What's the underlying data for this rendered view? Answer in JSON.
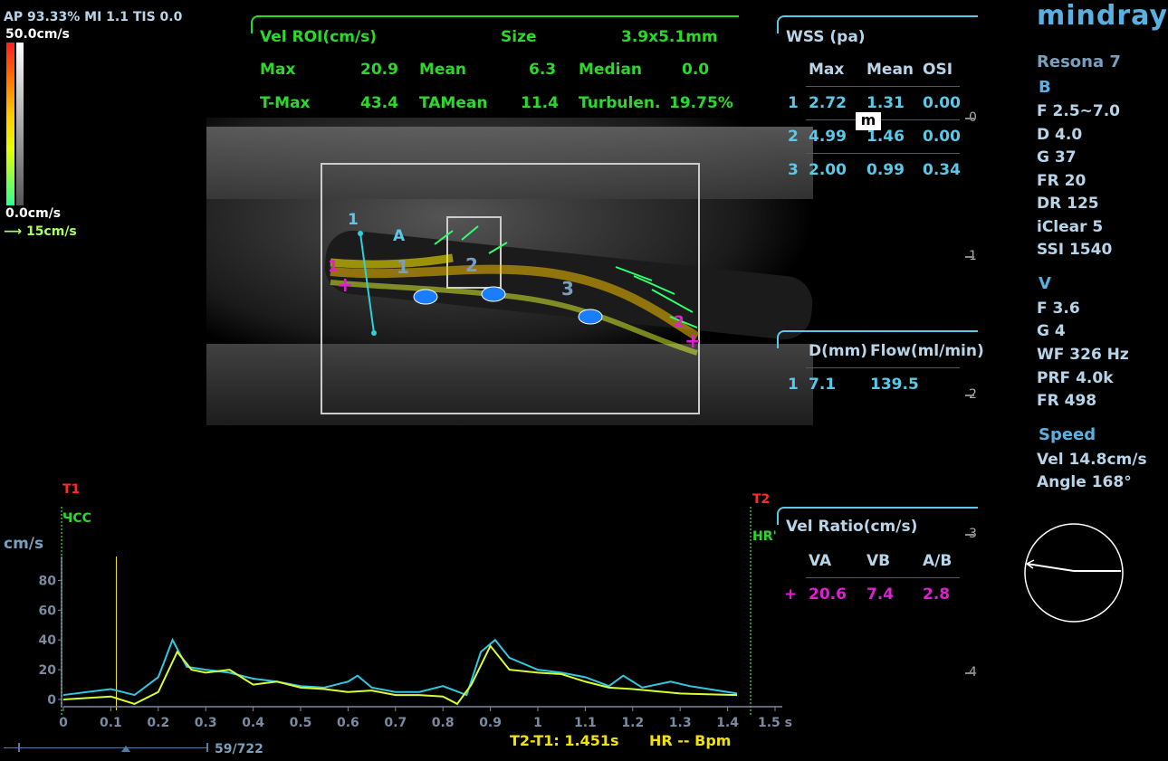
{
  "top_left": {
    "header": "AP 93.33%  MI 1.1 TIS 0.0",
    "scale_max": "50.0cm/s",
    "scale_min": "0.0cm/s",
    "vector_ref": "15cm/s"
  },
  "vel_roi": {
    "title": "Vel ROI(cm/s)",
    "size_label": "Size",
    "size_value": "3.9x5.1mm",
    "max_label": "Max",
    "max_value": "20.9",
    "mean_label": "Mean",
    "mean_value": "6.3",
    "median_label": "Median",
    "median_value": "0.0",
    "tmax_label": "T-Max",
    "tmax_value": "43.4",
    "tamean_label": "TAMean",
    "tamean_value": "11.4",
    "turb_label": "Turbulen.",
    "turb_value": "19.75%"
  },
  "wss": {
    "title": "WSS (pa)",
    "headers": [
      "Max",
      "Mean",
      "OSI"
    ],
    "rows": [
      {
        "idx": "1",
        "max": "2.72",
        "mean": "1.31",
        "osi": "0.00"
      },
      {
        "idx": "2",
        "max": "4.99",
        "mean": "1.46",
        "osi": "0.00"
      },
      {
        "idx": "3",
        "max": "2.00",
        "mean": "0.99",
        "osi": "0.34"
      }
    ]
  },
  "flow": {
    "d_label": "D(mm)",
    "flow_label": "Flow(ml/min)",
    "idx": "1",
    "d_value": "7.1",
    "flow_value": "139.5"
  },
  "vel_ratio": {
    "title": "Vel Ratio(cm/s)",
    "headers": [
      "VA",
      "VB",
      "A/B"
    ],
    "marker": "+",
    "va": "20.6",
    "vb": "7.4",
    "ab": "2.8"
  },
  "right_panel": {
    "brand": "mindray",
    "model": "Resona 7",
    "b_mode": "B",
    "b_params": [
      "F 2.5~7.0",
      "D 4.0",
      "G 37",
      "FR 20",
      "DR 125",
      "iClear 5",
      "SSI 1540"
    ],
    "v_mode": "V",
    "v_params": [
      "F 3.6",
      "G 4",
      "WF 326 Hz",
      "PRF 4.0k",
      "FR 498"
    ],
    "speed_title": "Speed",
    "speed_params": [
      "Vel 14.8cm/s",
      "Angle 168°"
    ]
  },
  "depth_scale": [
    "0",
    "1",
    "2",
    "3",
    "4"
  ],
  "roi_labels": {
    "line1": "1",
    "a": "A",
    "n1": "1",
    "n2": "2",
    "n3": "3",
    "m1": "1",
    "m2": "2",
    "plus": "+",
    "plus2": "+",
    "mark": "m"
  },
  "trace": {
    "unit": "cm/s",
    "t1": "T1",
    "t2": "T2",
    "hr_left": "ЧСС",
    "hr_right": "HR'",
    "y_ticks": [
      "80",
      "60",
      "40",
      "20",
      "0"
    ],
    "x_ticks": [
      "0",
      "0.1",
      "0.2",
      "0.3",
      "0.4",
      "0.5",
      "0.6",
      "0.7",
      "0.8",
      "0.9",
      "1",
      "1.1",
      "1.2",
      "1.3",
      "1.4",
      "1.5 s"
    ],
    "footer_dt": "T2-T1: 1.451s",
    "footer_hr": "HR -- Bpm",
    "frame_counter": "59/722"
  },
  "chart_data": {
    "type": "line",
    "xlabel": "s",
    "ylabel": "cm/s",
    "xlim": [
      0,
      1.5
    ],
    "ylim": [
      0,
      90
    ],
    "series": [
      {
        "values": [
          [
            0,
            3
          ],
          [
            0.05,
            5
          ],
          [
            0.1,
            7
          ],
          [
            0.15,
            3
          ],
          [
            0.2,
            15
          ],
          [
            0.23,
            40
          ],
          [
            0.26,
            22
          ],
          [
            0.3,
            20
          ],
          [
            0.35,
            18
          ],
          [
            0.4,
            14
          ],
          [
            0.45,
            12
          ],
          [
            0.5,
            9
          ],
          [
            0.55,
            8
          ],
          [
            0.6,
            12
          ],
          [
            0.62,
            16
          ],
          [
            0.65,
            8
          ],
          [
            0.7,
            5
          ],
          [
            0.75,
            5
          ],
          [
            0.8,
            9
          ],
          [
            0.85,
            3
          ],
          [
            0.88,
            32
          ],
          [
            0.91,
            40
          ],
          [
            0.94,
            28
          ],
          [
            1.0,
            20
          ],
          [
            1.05,
            18
          ],
          [
            1.1,
            15
          ],
          [
            1.15,
            9
          ],
          [
            1.18,
            16
          ],
          [
            1.22,
            8
          ],
          [
            1.28,
            12
          ],
          [
            1.32,
            9
          ],
          [
            1.38,
            6
          ],
          [
            1.42,
            4
          ]
        ]
      },
      {
        "values": [
          [
            0,
            0
          ],
          [
            0.05,
            1
          ],
          [
            0.1,
            2
          ],
          [
            0.15,
            -3
          ],
          [
            0.2,
            5
          ],
          [
            0.24,
            32
          ],
          [
            0.27,
            20
          ],
          [
            0.3,
            18
          ],
          [
            0.35,
            20
          ],
          [
            0.4,
            10
          ],
          [
            0.45,
            12
          ],
          [
            0.5,
            8
          ],
          [
            0.55,
            7
          ],
          [
            0.6,
            5
          ],
          [
            0.65,
            6
          ],
          [
            0.7,
            3
          ],
          [
            0.75,
            3
          ],
          [
            0.8,
            2
          ],
          [
            0.83,
            -3
          ],
          [
            0.86,
            10
          ],
          [
            0.9,
            36
          ],
          [
            0.94,
            20
          ],
          [
            1.0,
            18
          ],
          [
            1.05,
            17
          ],
          [
            1.1,
            12
          ],
          [
            1.15,
            8
          ],
          [
            1.2,
            7
          ],
          [
            1.3,
            4
          ],
          [
            1.42,
            3
          ]
        ]
      }
    ]
  }
}
